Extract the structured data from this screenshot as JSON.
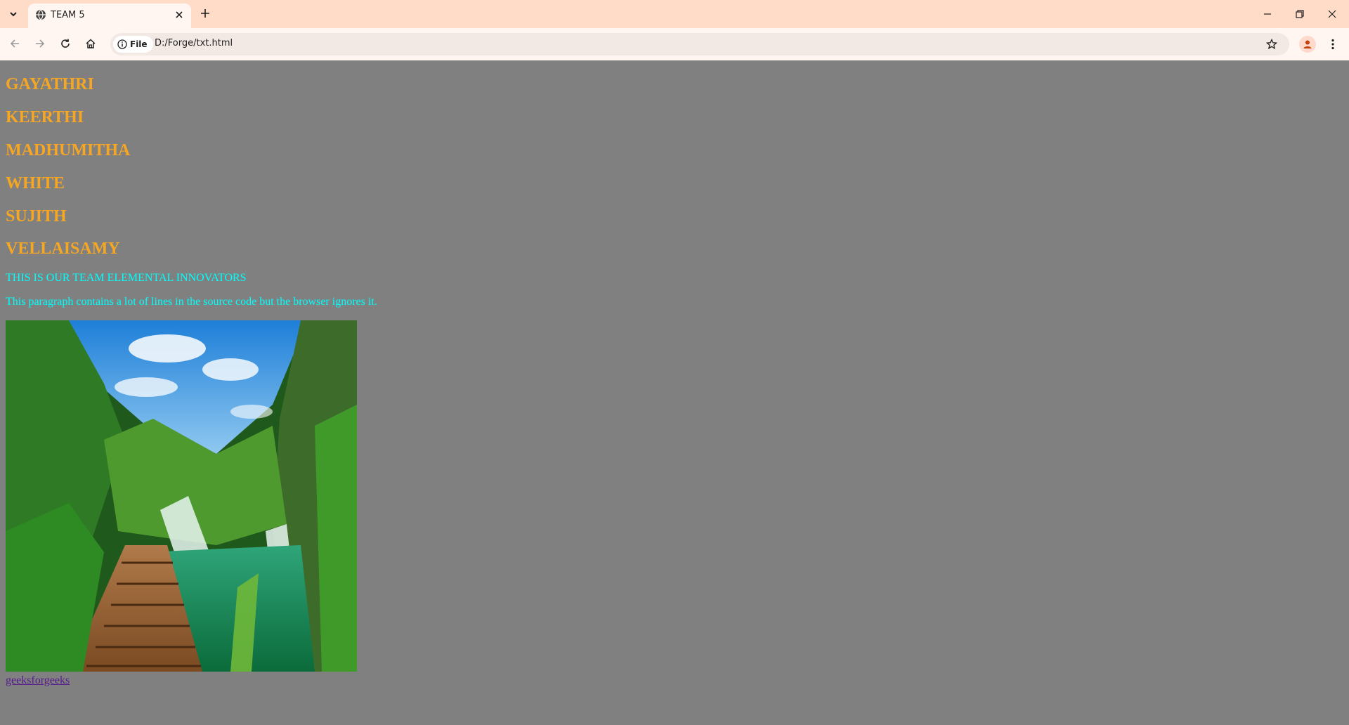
{
  "browser": {
    "tab_title": "TEAM 5",
    "security_chip_label": "File",
    "url": "D:/Forge/txt.html"
  },
  "page": {
    "names": [
      "GAYATHRI",
      "KEERTHI",
      "MADHUMITHA",
      "WHITE",
      "SUJITH",
      "VELLAISAMY"
    ],
    "team_line": "THIS IS OUR TEAM ELEMENTAL INNOVATORS",
    "paragraph": "This paragraph contains a lot of lines in the source code but the browser ignores it.",
    "link_text": "geeksforgeeks"
  },
  "colors": {
    "page_background": "#808080",
    "name_color": "#f5a623",
    "paragraph_color": "#00ffff",
    "link_color": "#551a8b",
    "chrome_frame": "#ffdcc8"
  },
  "icons": [
    "tab-search-icon",
    "globe-icon",
    "close-icon",
    "plus-icon",
    "minimize-icon",
    "restore-icon",
    "back-icon",
    "forward-icon",
    "reload-icon",
    "home-icon",
    "info-icon",
    "star-icon",
    "profile-icon",
    "kebab-menu-icon"
  ]
}
